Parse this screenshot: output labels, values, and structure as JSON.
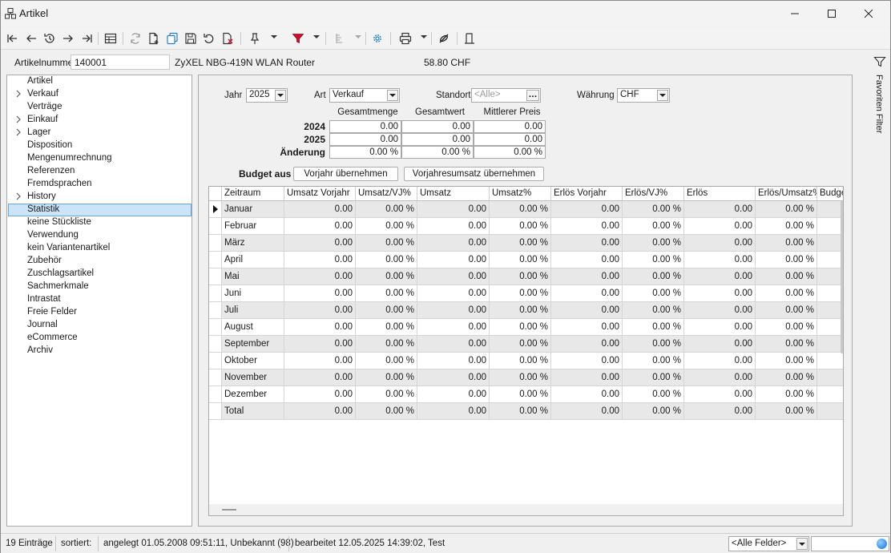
{
  "window": {
    "title": "Artikel"
  },
  "header": {
    "number_label": "Artikelnummer",
    "number_value": "140001",
    "description": "ZyXEL NBG-419N WLAN Router",
    "price": "58.80  CHF"
  },
  "favorites": {
    "label": "Favoriten Filter"
  },
  "nav": {
    "items": [
      {
        "label": "Artikel",
        "expandable": false
      },
      {
        "label": "Verkauf",
        "expandable": true
      },
      {
        "label": "Verträge",
        "expandable": false
      },
      {
        "label": "Einkauf",
        "expandable": true
      },
      {
        "label": "Lager",
        "expandable": true
      },
      {
        "label": "Disposition",
        "expandable": false
      },
      {
        "label": "Mengenumrechnung",
        "expandable": false
      },
      {
        "label": "Referenzen",
        "expandable": false
      },
      {
        "label": "Fremdsprachen",
        "expandable": false
      },
      {
        "label": "History",
        "expandable": true
      },
      {
        "label": "Statistik",
        "expandable": false,
        "selected": true
      },
      {
        "label": "keine Stückliste",
        "expandable": false
      },
      {
        "label": "Verwendung",
        "expandable": false
      },
      {
        "label": "kein Variantenartikel",
        "expandable": false
      },
      {
        "label": "Zubehör",
        "expandable": false
      },
      {
        "label": "Zuschlagsartikel",
        "expandable": false
      },
      {
        "label": "Sachmerkmale",
        "expandable": false
      },
      {
        "label": "Intrastat",
        "expandable": false
      },
      {
        "label": "Freie Felder",
        "expandable": false
      },
      {
        "label": "Journal",
        "expandable": false
      },
      {
        "label": "eCommerce",
        "expandable": false
      },
      {
        "label": "Archiv",
        "expandable": false
      }
    ]
  },
  "filters": {
    "jahr_label": "Jahr",
    "jahr_value": "2025",
    "art_label": "Art",
    "art_value": "Verkauf",
    "standort_label": "Standort",
    "standort_placeholder": "<Alle>",
    "waehrung_label": "Währung",
    "waehrung_value": "CHF"
  },
  "summary": {
    "headers": [
      "Gesamtmenge",
      "Gesamtwert",
      "Mittlerer Preis"
    ],
    "rows": [
      {
        "label": "2024",
        "values": [
          "0.00",
          "0.00",
          "0.00"
        ]
      },
      {
        "label": "2025",
        "values": [
          "0.00",
          "0.00",
          "0.00"
        ]
      },
      {
        "label": "Änderung",
        "values": [
          "0.00 %",
          "0.00 %",
          "0.00 %"
        ]
      }
    ]
  },
  "budget": {
    "label": "Budget aus",
    "btn_vorjahr": "Vorjahr übernehmen",
    "btn_umsatz": "Vorjahresumsatz übernehmen"
  },
  "grid": {
    "columns": [
      "Zeitraum",
      "Umsatz Vorjahr",
      "Umsatz/VJ%",
      "Umsatz",
      "Umsatz%",
      "Erlös Vorjahr",
      "Erlös/VJ%",
      "Erlös",
      "Erlös/Umsatz%",
      "Budge"
    ],
    "rows": [
      [
        "Januar",
        "0.00",
        "0.00 %",
        "0.00",
        "0.00 %",
        "0.00",
        "0.00 %",
        "0.00",
        "0.00 %"
      ],
      [
        "Februar",
        "0.00",
        "0.00 %",
        "0.00",
        "0.00 %",
        "0.00",
        "0.00 %",
        "0.00",
        "0.00 %"
      ],
      [
        "März",
        "0.00",
        "0.00 %",
        "0.00",
        "0.00 %",
        "0.00",
        "0.00 %",
        "0.00",
        "0.00 %"
      ],
      [
        "April",
        "0.00",
        "0.00 %",
        "0.00",
        "0.00 %",
        "0.00",
        "0.00 %",
        "0.00",
        "0.00 %"
      ],
      [
        "Mai",
        "0.00",
        "0.00 %",
        "0.00",
        "0.00 %",
        "0.00",
        "0.00 %",
        "0.00",
        "0.00 %"
      ],
      [
        "Juni",
        "0.00",
        "0.00 %",
        "0.00",
        "0.00 %",
        "0.00",
        "0.00 %",
        "0.00",
        "0.00 %"
      ],
      [
        "Juli",
        "0.00",
        "0.00 %",
        "0.00",
        "0.00 %",
        "0.00",
        "0.00 %",
        "0.00",
        "0.00 %"
      ],
      [
        "August",
        "0.00",
        "0.00 %",
        "0.00",
        "0.00 %",
        "0.00",
        "0.00 %",
        "0.00",
        "0.00 %"
      ],
      [
        "September",
        "0.00",
        "0.00 %",
        "0.00",
        "0.00 %",
        "0.00",
        "0.00 %",
        "0.00",
        "0.00 %"
      ],
      [
        "Oktober",
        "0.00",
        "0.00 %",
        "0.00",
        "0.00 %",
        "0.00",
        "0.00 %",
        "0.00",
        "0.00 %"
      ],
      [
        "November",
        "0.00",
        "0.00 %",
        "0.00",
        "0.00 %",
        "0.00",
        "0.00 %",
        "0.00",
        "0.00 %"
      ],
      [
        "Dezember",
        "0.00",
        "0.00 %",
        "0.00",
        "0.00 %",
        "0.00",
        "0.00 %",
        "0.00",
        "0.00 %"
      ],
      [
        "Total",
        "0.00",
        "0.00 %",
        "0.00",
        "0.00 %",
        "0.00",
        "0.00 %",
        "0.00",
        "0.00 %"
      ]
    ]
  },
  "statusbar": {
    "entries": "19 Einträge",
    "sorted": "sortiert:",
    "created": "angelegt 01.05.2008 09:51:11, Unbekannt (98)",
    "edited": "bearbeitet 12.05.2025 14:39:02, Test",
    "fields_combo": "<Alle Felder>"
  },
  "toolbar": {
    "icons": [
      "first-record-icon",
      "previous-record-icon",
      "history-icon",
      "next-record-icon",
      "last-record-icon",
      "table-view-icon",
      "refresh-icon",
      "new-document-icon",
      "copy-icon",
      "save-icon",
      "undo-icon",
      "delete-icon",
      "pin-icon",
      "filter-icon",
      "sort-icon",
      "settings-icon",
      "print-icon",
      "link-icon",
      "bookmark-icon"
    ]
  },
  "colors": {
    "selection_bg": "#cce4f7",
    "selection_border": "#6aa6d8",
    "filter_red": "#c8102e",
    "settings_blue": "#2a7fc0"
  }
}
